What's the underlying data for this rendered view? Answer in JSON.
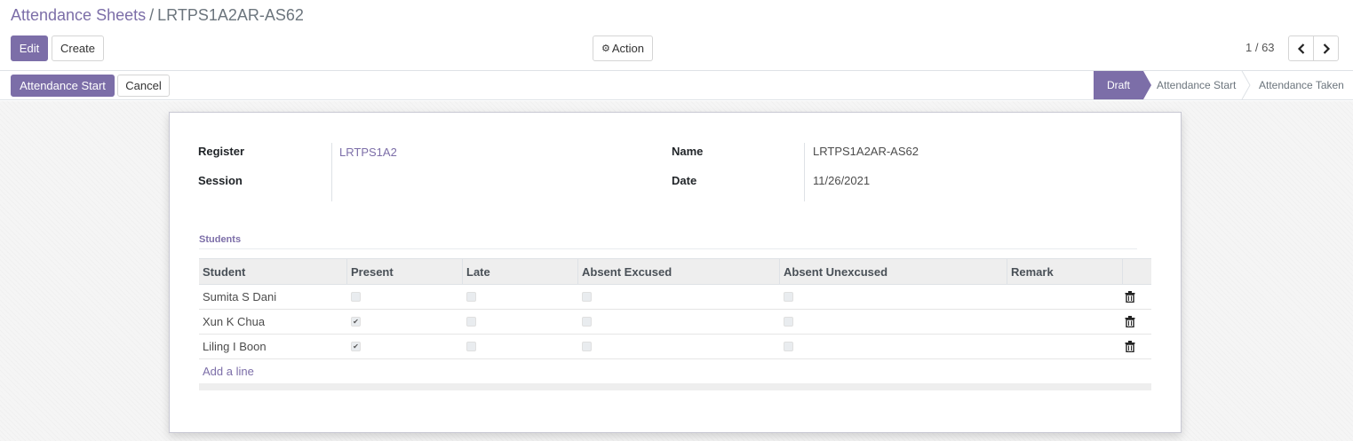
{
  "breadcrumb": {
    "parent": "Attendance Sheets",
    "separator": "/",
    "current": "LRTPS1A2AR-AS62"
  },
  "toolbar": {
    "edit_label": "Edit",
    "create_label": "Create",
    "action_label": "Action",
    "action_icon": "gear-icon"
  },
  "pager": {
    "value": "1 / 63",
    "prev_icon": "chevron-left-icon",
    "next_icon": "chevron-right-icon"
  },
  "statusbar": {
    "start_label": "Attendance Start",
    "cancel_label": "Cancel",
    "stages": [
      {
        "label": "Draft",
        "active": true
      },
      {
        "label": "Attendance Start",
        "active": false
      },
      {
        "label": "Attendance Taken",
        "active": false
      }
    ]
  },
  "form": {
    "register_label": "Register",
    "register_value": "LRTPS1A2",
    "session_label": "Session",
    "session_value": "",
    "name_label": "Name",
    "name_value": "LRTPS1A2AR-AS62",
    "date_label": "Date",
    "date_value": "11/26/2021"
  },
  "students": {
    "section_title": "Students",
    "columns": [
      "Student",
      "Present",
      "Late",
      "Absent Excused",
      "Absent Unexcused",
      "Remark"
    ],
    "rows": [
      {
        "student": "Sumita S Dani",
        "present": false,
        "late": false,
        "absent_excused": false,
        "absent_unexcused": false,
        "remark": ""
      },
      {
        "student": "Xun K Chua",
        "present": true,
        "late": false,
        "absent_excused": false,
        "absent_unexcused": false,
        "remark": ""
      },
      {
        "student": "Liling I Boon",
        "present": true,
        "late": false,
        "absent_excused": false,
        "absent_unexcused": false,
        "remark": ""
      }
    ],
    "add_line_label": "Add a line"
  },
  "colors": {
    "accent": "#7c6ea8",
    "text": "#4c4c4c",
    "border": "#dee2e6"
  }
}
